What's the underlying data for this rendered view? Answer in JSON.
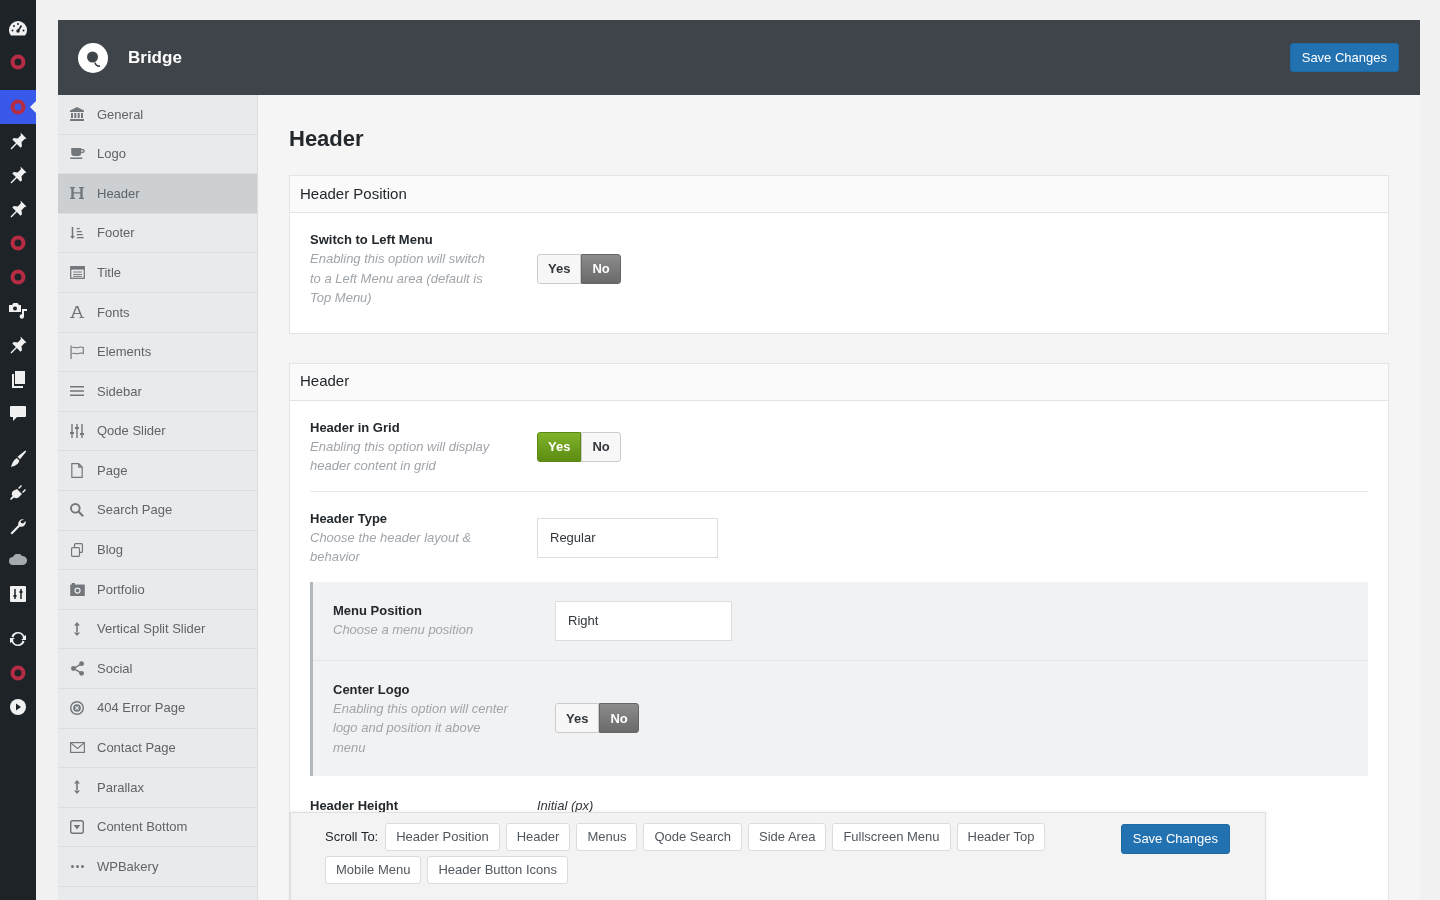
{
  "admin_menu": {
    "groups": [
      {
        "items": [
          {
            "selected": false
          },
          {
            "selected": false
          }
        ]
      },
      {
        "items": [
          {
            "selected": true
          },
          {
            "selected": false
          },
          {
            "selected": false
          },
          {
            "selected": false
          },
          {
            "selected": false
          },
          {
            "selected": false
          },
          {
            "selected": false
          },
          {
            "selected": false
          },
          {
            "selected": false
          },
          {
            "selected": false
          }
        ]
      },
      {
        "items": [
          {
            "selected": false
          },
          {
            "selected": false
          },
          {
            "selected": false
          },
          {
            "selected": false
          },
          {
            "selected": false
          }
        ]
      },
      {
        "items": [
          {
            "selected": false
          },
          {
            "selected": false
          },
          {
            "selected": false
          }
        ]
      }
    ]
  },
  "top_bar": {
    "theme_name": "Bridge",
    "save_button": "Save Changes"
  },
  "sidebar": {
    "items": [
      {
        "label": "General",
        "selected": false
      },
      {
        "label": "Logo",
        "selected": false
      },
      {
        "label": "Header",
        "selected": true
      },
      {
        "label": "Footer",
        "selected": false
      },
      {
        "label": "Title",
        "selected": false
      },
      {
        "label": "Fonts",
        "selected": false
      },
      {
        "label": "Elements",
        "selected": false
      },
      {
        "label": "Sidebar",
        "selected": false
      },
      {
        "label": "Qode Slider",
        "selected": false
      },
      {
        "label": "Page",
        "selected": false
      },
      {
        "label": "Search Page",
        "selected": false
      },
      {
        "label": "Blog",
        "selected": false
      },
      {
        "label": "Portfolio",
        "selected": false
      },
      {
        "label": "Vertical Split Slider",
        "selected": false
      },
      {
        "label": "Social",
        "selected": false
      },
      {
        "label": "404 Error Page",
        "selected": false
      },
      {
        "label": "Contact Page",
        "selected": false
      },
      {
        "label": "Parallax",
        "selected": false
      },
      {
        "label": "Content Bottom",
        "selected": false
      },
      {
        "label": "WPBakery",
        "selected": false
      }
    ]
  },
  "page_title": "Header",
  "panels": [
    {
      "title": "Header Position",
      "rows": [
        {
          "kind": "toggle",
          "label": "Switch to Left Menu",
          "description": "Enabling this option will switch to a Left Menu area (default is Top Menu)",
          "options": [
            {
              "label": "Yes",
              "selected": false
            },
            {
              "label": "No",
              "selected": true
            }
          ]
        }
      ]
    },
    {
      "title": "Header",
      "rows": [
        {
          "kind": "toggle",
          "label": "Header in Grid",
          "description": "Enabling this option will display header content in grid",
          "options": [
            {
              "label": "Yes",
              "selected": true
            },
            {
              "label": "No",
              "selected": false
            }
          ]
        },
        {
          "kind": "select",
          "label": "Header Type",
          "description": "Choose the header layout & behavior",
          "value": "Regular"
        },
        {
          "kind": "group",
          "rows": [
            {
              "kind": "select",
              "label": "Menu Position",
              "description": "Choose a menu position",
              "value": "Right"
            },
            {
              "kind": "toggle",
              "label": "Center Logo",
              "description": "Enabling this option will center logo and position it above menu",
              "options": [
                {
                  "label": "Yes",
                  "selected": false
                },
                {
                  "label": "No",
                  "selected": true
                }
              ]
            }
          ]
        },
        {
          "kind": "partial",
          "label": "Header Height",
          "field_label": "Initial (px)"
        }
      ]
    }
  ],
  "scroll_bar": {
    "label": "Scroll To:",
    "links": [
      "Header Position",
      "Header",
      "Menus",
      "Qode Search",
      "Side Area",
      "Fullscreen Menu",
      "Header Top",
      "Mobile Menu",
      "Header Button Icons"
    ],
    "save_button": "Save Changes"
  }
}
